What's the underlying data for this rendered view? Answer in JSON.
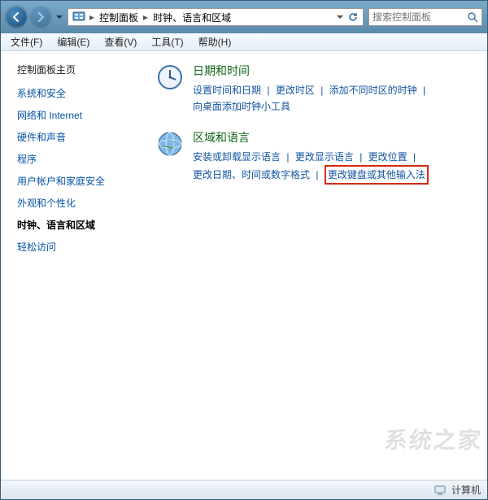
{
  "breadcrumb": {
    "root_icon_name": "control-panel-icon",
    "part1": "控制面板",
    "part2": "时钟、语言和区域"
  },
  "search": {
    "placeholder": "搜索控制面板"
  },
  "menubar": {
    "file": "文件(F)",
    "edit": "编辑(E)",
    "view": "查看(V)",
    "tools": "工具(T)",
    "help": "帮助(H)"
  },
  "sidebar": {
    "home": "控制面板主页",
    "items": [
      {
        "label": "系统和安全"
      },
      {
        "label": "网络和 Internet"
      },
      {
        "label": "硬件和声音"
      },
      {
        "label": "程序"
      },
      {
        "label": "用户帐户和家庭安全"
      },
      {
        "label": "外观和个性化"
      },
      {
        "label": "时钟、语言和区域",
        "current": true
      },
      {
        "label": "轻松访问"
      }
    ]
  },
  "sections": {
    "datetime": {
      "title": "日期和时间",
      "links": {
        "set_dt": "设置时间和日期",
        "change_tz": "更改时区",
        "add_clock": "添加不同时区的时钟",
        "gadget": "向桌面添加时钟小工具"
      }
    },
    "region": {
      "title": "区域和语言",
      "links": {
        "install_lang": "安装或卸载显示语言",
        "change_disp_lang": "更改显示语言",
        "change_loc": "更改位置",
        "change_format": "更改日期、时间或数字格式",
        "change_ime": "更改键盘或其他输入法"
      }
    }
  },
  "statusbar": {
    "text": "计算机"
  },
  "watermark": "系统之家"
}
